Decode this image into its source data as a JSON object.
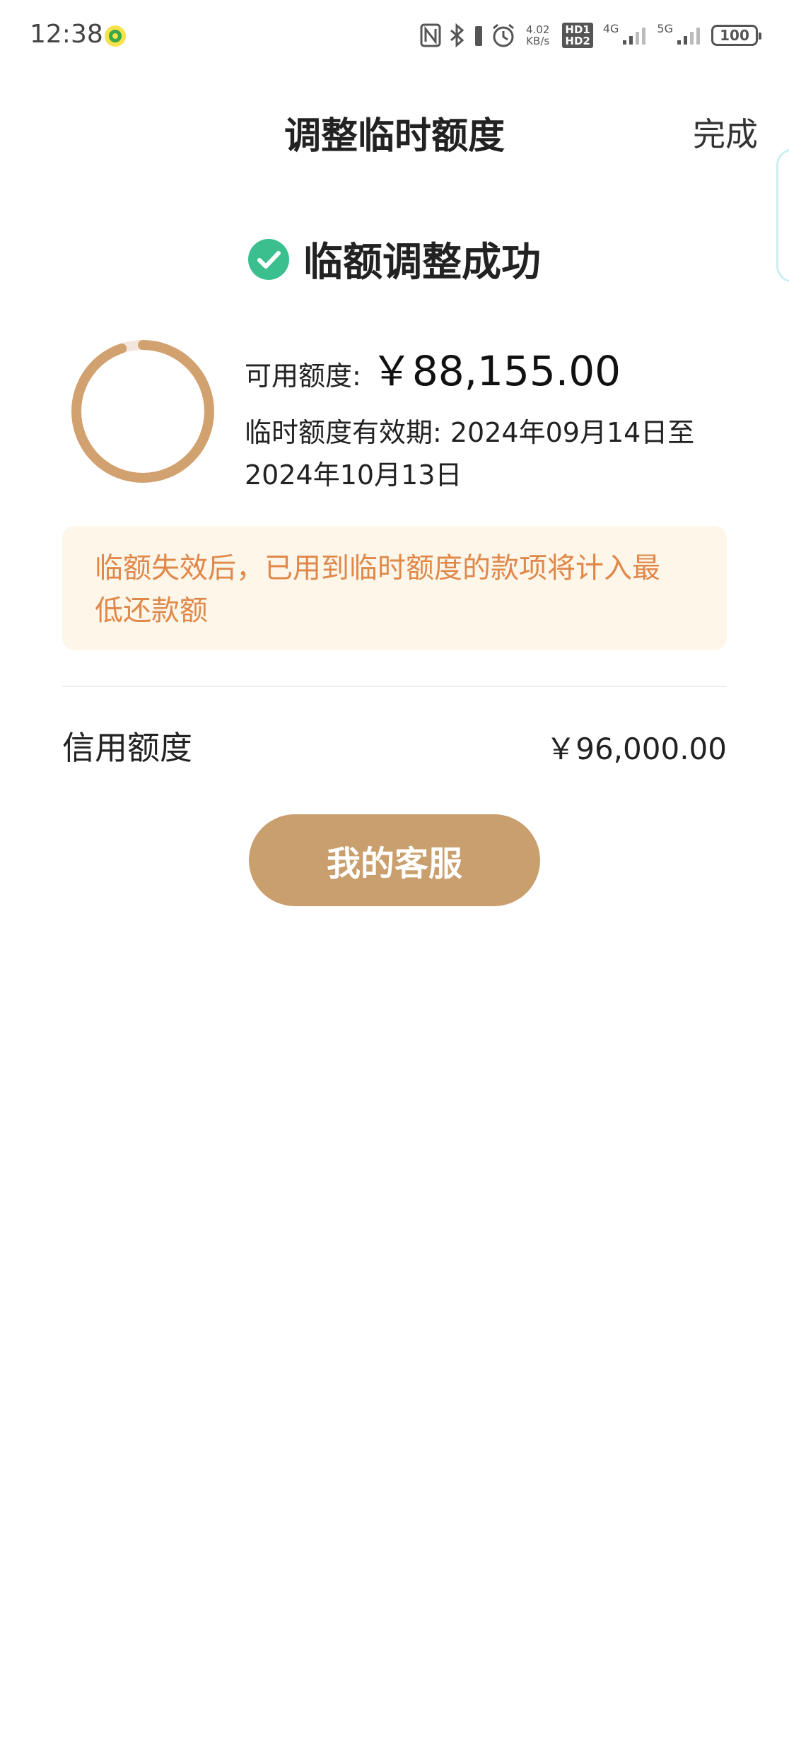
{
  "status_bar": {
    "time": "12:38",
    "net_speed_value": "4.02",
    "net_speed_unit": "KB/s",
    "hd1": "HD1",
    "hd2": "HD2",
    "sig1": "4G",
    "sig2": "5G",
    "battery": "100",
    "icons": [
      "nfc-icon",
      "bluetooth-icon",
      "alarm-icon",
      "signal-icon",
      "battery-icon"
    ]
  },
  "header": {
    "title": "调整临时额度",
    "done_label": "完成"
  },
  "result": {
    "success_text": "临额调整成功",
    "success_color": "#3cbf8f",
    "available_label": "可用额度:",
    "available_amount": "￥88,155.00",
    "validity_line1": "临时额度有效期: 2024年09月14日至",
    "validity_line2": "2024年10月13日"
  },
  "notice": {
    "line1": "临额失效后，已用到临时额度的款项将计入最",
    "line2": "低还款额"
  },
  "credit": {
    "label": "信用额度",
    "value": "￥96,000.00"
  },
  "service_button": {
    "label": "我的客服"
  },
  "colors": {
    "accent": "#c99f6e",
    "notice_text": "#e0884a",
    "notice_bg": "#fdf6e9"
  }
}
